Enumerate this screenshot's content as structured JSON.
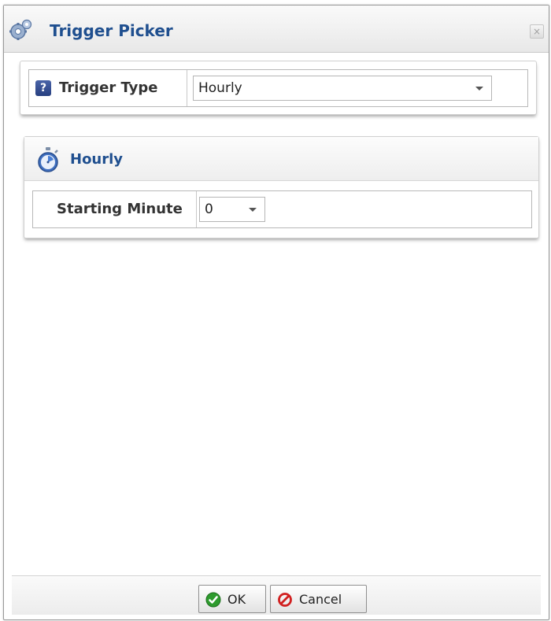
{
  "window": {
    "title": "Trigger Picker",
    "close_glyph": "×",
    "title_icon": "gears-icon",
    "accent_color": "#1f4f8f"
  },
  "trigger_type": {
    "help_glyph": "?",
    "label": "Trigger Type",
    "selected": "Hourly"
  },
  "hourly": {
    "title": "Hourly",
    "icon": "stopwatch-icon",
    "starting_minute_label": "Starting Minute",
    "starting_minute_value": "0"
  },
  "buttons": {
    "ok_label": "OK",
    "cancel_label": "Cancel",
    "ok_icon_color": "#2e9b2e",
    "cancel_icon_color": "#d11f1f"
  }
}
